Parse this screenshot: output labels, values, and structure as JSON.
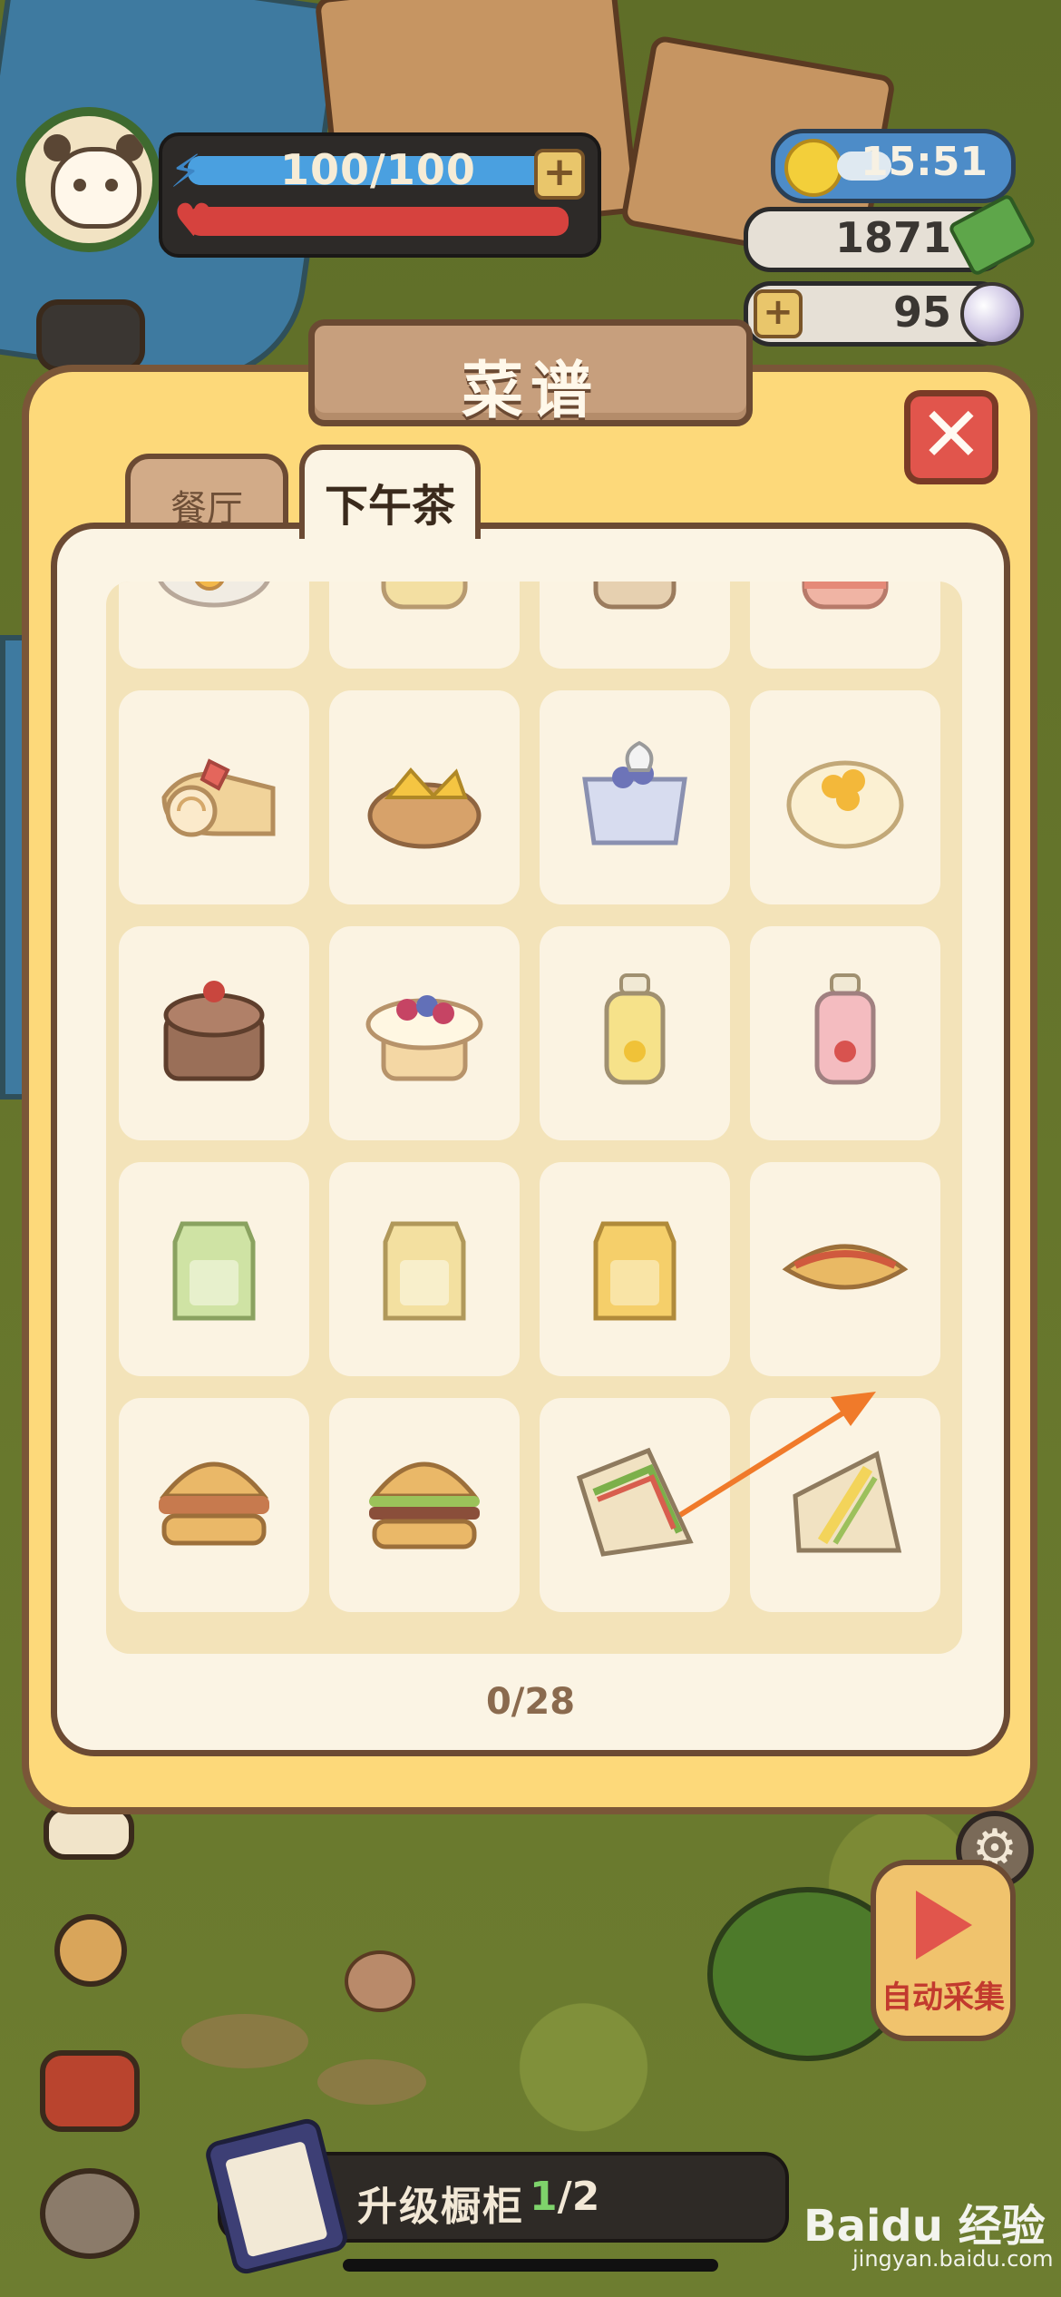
{
  "hud": {
    "energy": "100/100",
    "energy_plus": "+",
    "time": "15:51",
    "money": "1871",
    "pearls": "95",
    "pearl_plus": "+"
  },
  "dialog": {
    "title": "菜谱",
    "close": "✕",
    "tabs": [
      {
        "label": "餐厅",
        "active": false
      },
      {
        "label": "下午茶",
        "active": true
      }
    ],
    "progress": "0/28",
    "items": [
      {
        "name": "caramel-popcorn-bowl"
      },
      {
        "name": "pudding-jar"
      },
      {
        "name": "chocolate-muffin"
      },
      {
        "name": "strawberry-cake-jar"
      },
      {
        "name": "strawberry-swiss-roll"
      },
      {
        "name": "mango-tart"
      },
      {
        "name": "blueberry-pudding-cup"
      },
      {
        "name": "mango-cream-cake"
      },
      {
        "name": "chocolate-layer-cake"
      },
      {
        "name": "berry-cream-cake"
      },
      {
        "name": "lemon-juice-bottle"
      },
      {
        "name": "strawberry-milk-bottle"
      },
      {
        "name": "matcha-milk-carton"
      },
      {
        "name": "banana-milk-carton"
      },
      {
        "name": "mango-milk-carton"
      },
      {
        "name": "taco"
      },
      {
        "name": "chicken-burger"
      },
      {
        "name": "beef-burger"
      },
      {
        "name": "club-sandwich"
      },
      {
        "name": "egg-sandwich"
      }
    ]
  },
  "bottom": {
    "upgrade_label": "升级橱柜",
    "upgrade_current": "1",
    "upgrade_total": "/2",
    "auto_collect": "自动采集"
  },
  "watermark": {
    "brand": "Baidu 经验",
    "sub": "jingyan.baidu.com"
  },
  "colors": {
    "dialog_bg": "#fdd97a",
    "panel_bg": "#fbf4e4",
    "border_brown": "#6b4a33",
    "close_red": "#e1554c",
    "annotation_arrow": "#f07a2a"
  }
}
